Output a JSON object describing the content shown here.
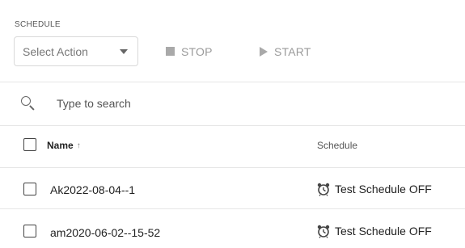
{
  "section_title": "SCHEDULE",
  "toolbar": {
    "select_action_label": "Select Action",
    "stop_label": "STOP",
    "start_label": "START"
  },
  "search": {
    "placeholder": "Type to search"
  },
  "table": {
    "columns": [
      {
        "label": "Name",
        "sort_icon": "sort-ascending-arrow"
      },
      {
        "label": "Schedule"
      }
    ],
    "rows": [
      {
        "name": "Ak2022-08-04--1",
        "schedule": "Test Schedule OFF",
        "schedule_icon": "alarm-clock-icon"
      },
      {
        "name": "am2020-06-02--15-52",
        "schedule": "Test Schedule OFF",
        "schedule_icon": "alarm-clock-icon"
      }
    ]
  },
  "colors": {
    "divider": "#e6e6e6",
    "muted_text": "#9a9a9a",
    "text": "#222222"
  }
}
